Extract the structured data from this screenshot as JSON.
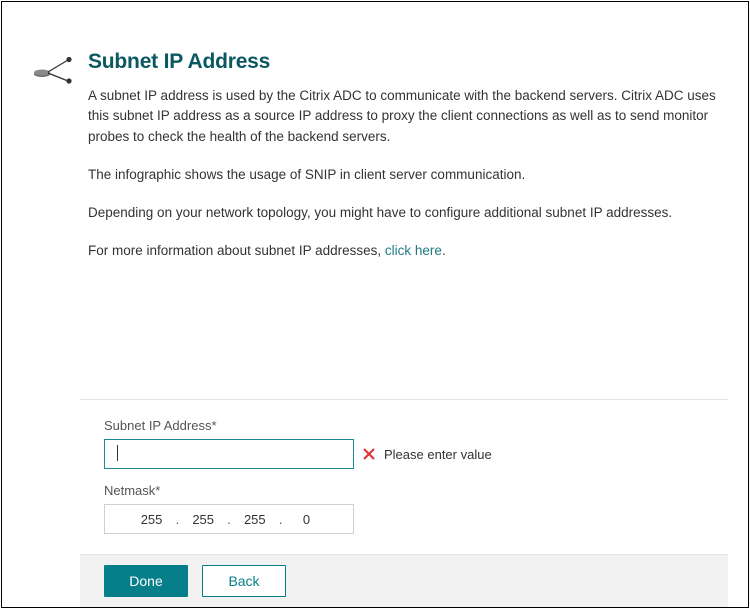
{
  "header": {
    "title": "Subnet IP Address",
    "paragraphs": {
      "p1": "A subnet IP address is used by the Citrix ADC to communicate with the backend servers. Citrix ADC uses this subnet IP address as a source IP address to proxy the client connections as well as to send monitor probes to check the health of the backend servers.",
      "p2": "The infographic shows the usage of SNIP in client server communication.",
      "p3": "Depending on your network topology, you might have to configure additional subnet IP addresses.",
      "p4_pre": "For more information about subnet IP addresses, ",
      "p4_link": "click here",
      "p4_post": "."
    }
  },
  "form": {
    "subnet_label": "Subnet IP Address*",
    "subnet_value": "",
    "error_message": "Please enter value",
    "netmask_label": "Netmask*",
    "netmask_octets": {
      "o1": "255",
      "o2": "255",
      "o3": "255",
      "o4": "0"
    }
  },
  "buttons": {
    "done": "Done",
    "back": "Back"
  },
  "colors": {
    "accent": "#067f8a",
    "heading": "#0b5861",
    "error": "#d33"
  }
}
